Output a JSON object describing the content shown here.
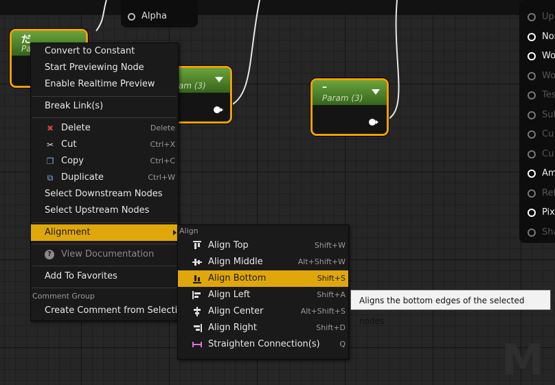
{
  "graph": {
    "alpha_label": "Alpha",
    "nodes": [
      {
        "title": "だ",
        "sub": "Pa"
      },
      {
        "title": "",
        "sub": "ram (3)"
      },
      {
        "title": "–",
        "sub": "Param (3)"
      }
    ],
    "right_pins": [
      {
        "label": "Up",
        "active": false
      },
      {
        "label": "Nor",
        "active": true
      },
      {
        "label": "Wo",
        "active": true
      },
      {
        "label": "Wo",
        "active": false
      },
      {
        "label": "Tes",
        "active": false
      },
      {
        "label": "Sul",
        "active": false
      },
      {
        "label": "Cu",
        "active": false
      },
      {
        "label": "Cu",
        "active": false
      },
      {
        "label": "Am",
        "active": true
      },
      {
        "label": "Ref",
        "active": false
      },
      {
        "label": "Pix",
        "active": true
      },
      {
        "label": "Sha",
        "active": false
      }
    ]
  },
  "context_menu": {
    "convert": "Convert to Constant",
    "start_preview": "Start Previewing Node",
    "realtime": "Enable Realtime Preview",
    "break_links": "Break Link(s)",
    "delete": {
      "label": "Delete",
      "key": "Delete"
    },
    "cut": {
      "label": "Cut",
      "key": "Ctrl+X"
    },
    "copy": {
      "label": "Copy",
      "key": "Ctrl+C"
    },
    "duplicate": {
      "label": "Duplicate",
      "key": "Ctrl+W"
    },
    "select_downstream": "Select Downstream Nodes",
    "select_upstream": "Select Upstream Nodes",
    "alignment": "Alignment",
    "view_docs": "View Documentation",
    "favorites": "Add To Favorites",
    "comment_group": "Comment Group",
    "create_comment": "Create Comment from Selection"
  },
  "align_menu": {
    "section": "Align",
    "items": [
      {
        "label": "Align Top",
        "key": "Shift+W"
      },
      {
        "label": "Align Middle",
        "key": "Alt+Shift+W"
      },
      {
        "label": "Align Bottom",
        "key": "Shift+S"
      },
      {
        "label": "Align Left",
        "key": "Shift+A"
      },
      {
        "label": "Align Center",
        "key": "Alt+Shift+S"
      },
      {
        "label": "Align Right",
        "key": "Shift+D"
      },
      {
        "label": "Straighten Connection(s)",
        "key": "Q"
      }
    ]
  },
  "tooltip": "Aligns the bottom edges of the selected nodes",
  "watermark": "M",
  "colors": {
    "accent": "#e0a70b",
    "node_border": "#f0a000",
    "node_header": "#4e8a2c"
  }
}
